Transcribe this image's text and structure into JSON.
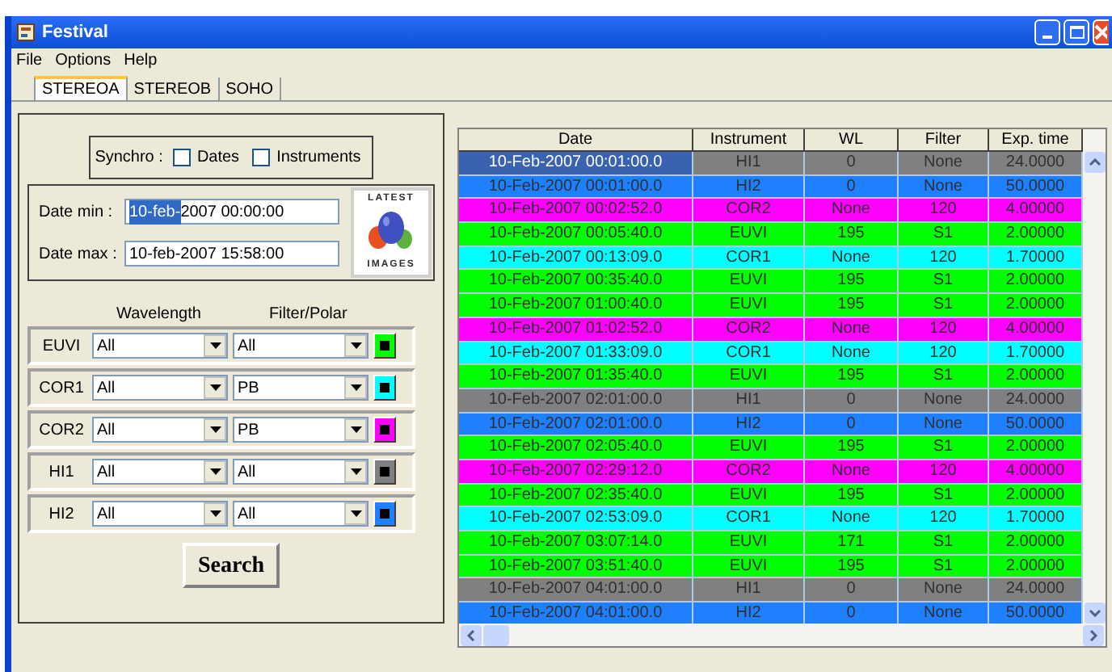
{
  "window": {
    "title": "Festival"
  },
  "menu": [
    "File",
    "Options",
    "Help"
  ],
  "tabs": [
    {
      "label": "STEREOA",
      "selected": true
    },
    {
      "label": "STEREOB",
      "selected": false
    },
    {
      "label": "SOHO",
      "selected": false
    }
  ],
  "synchro": {
    "label": "Synchro :",
    "options": [
      {
        "label": "Dates",
        "checked": false
      },
      {
        "label": "Instruments",
        "checked": false
      }
    ]
  },
  "date_min": {
    "label": "Date min :",
    "value_selected": "10-feb-",
    "value_rest": "2007 00:00:00"
  },
  "date_max": {
    "label": "Date max :",
    "value": "10-feb-2007 15:58:00"
  },
  "latest_images": {
    "top": "LATEST",
    "bottom": "IMAGES"
  },
  "filter_headers": [
    "Wavelength",
    "Filter/Polar"
  ],
  "instruments": [
    {
      "name": "EUVI",
      "wavelength": "All",
      "filter": "All",
      "color": "#00ff00"
    },
    {
      "name": "COR1",
      "wavelength": "All",
      "filter": "PB",
      "color": "#00ffff"
    },
    {
      "name": "COR2",
      "wavelength": "All",
      "filter": "PB",
      "color": "#ff00ff"
    },
    {
      "name": "HI1",
      "wavelength": "All",
      "filter": "All",
      "color": "#808080"
    },
    {
      "name": "HI2",
      "wavelength": "All",
      "filter": "All",
      "color": "#1e7fff"
    }
  ],
  "search_button": "Search",
  "table": {
    "columns": [
      "Date",
      "Instrument",
      "WL",
      "Filter",
      "Exp. time"
    ],
    "rows": [
      {
        "cells": [
          "10-Feb-2007 00:01:00.0",
          "HI1",
          "0",
          "None",
          "24.0000"
        ],
        "color": "#808080",
        "selected": true
      },
      {
        "cells": [
          "10-Feb-2007 00:01:00.0",
          "HI2",
          "0",
          "None",
          "50.0000"
        ],
        "color": "#1e7fff",
        "selected": false
      },
      {
        "cells": [
          "10-Feb-2007 00:02:52.0",
          "COR2",
          "None",
          "120",
          "4.00000"
        ],
        "color": "#ff00ff",
        "selected": false
      },
      {
        "cells": [
          "10-Feb-2007 00:05:40.0",
          "EUVI",
          "195",
          "S1",
          "2.00000"
        ],
        "color": "#00ff00",
        "selected": false
      },
      {
        "cells": [
          "10-Feb-2007 00:13:09.0",
          "COR1",
          "None",
          "120",
          "1.70000"
        ],
        "color": "#00ffff",
        "selected": false
      },
      {
        "cells": [
          "10-Feb-2007 00:35:40.0",
          "EUVI",
          "195",
          "S1",
          "2.00000"
        ],
        "color": "#00ff00",
        "selected": false
      },
      {
        "cells": [
          "10-Feb-2007 01:00:40.0",
          "EUVI",
          "195",
          "S1",
          "2.00000"
        ],
        "color": "#00ff00",
        "selected": false
      },
      {
        "cells": [
          "10-Feb-2007 01:02:52.0",
          "COR2",
          "None",
          "120",
          "4.00000"
        ],
        "color": "#ff00ff",
        "selected": false
      },
      {
        "cells": [
          "10-Feb-2007 01:33:09.0",
          "COR1",
          "None",
          "120",
          "1.70000"
        ],
        "color": "#00ffff",
        "selected": false
      },
      {
        "cells": [
          "10-Feb-2007 01:35:40.0",
          "EUVI",
          "195",
          "S1",
          "2.00000"
        ],
        "color": "#00ff00",
        "selected": false
      },
      {
        "cells": [
          "10-Feb-2007 02:01:00.0",
          "HI1",
          "0",
          "None",
          "24.0000"
        ],
        "color": "#808080",
        "selected": false
      },
      {
        "cells": [
          "10-Feb-2007 02:01:00.0",
          "HI2",
          "0",
          "None",
          "50.0000"
        ],
        "color": "#1e7fff",
        "selected": false
      },
      {
        "cells": [
          "10-Feb-2007 02:05:40.0",
          "EUVI",
          "195",
          "S1",
          "2.00000"
        ],
        "color": "#00ff00",
        "selected": false
      },
      {
        "cells": [
          "10-Feb-2007 02:29:12.0",
          "COR2",
          "None",
          "120",
          "4.00000"
        ],
        "color": "#ff00ff",
        "selected": false
      },
      {
        "cells": [
          "10-Feb-2007 02:35:40.0",
          "EUVI",
          "195",
          "S1",
          "2.00000"
        ],
        "color": "#00ff00",
        "selected": false
      },
      {
        "cells": [
          "10-Feb-2007 02:53:09.0",
          "COR1",
          "None",
          "120",
          "1.70000"
        ],
        "color": "#00ffff",
        "selected": false
      },
      {
        "cells": [
          "10-Feb-2007 03:07:14.0",
          "EUVI",
          "171",
          "S1",
          "2.00000"
        ],
        "color": "#00ff00",
        "selected": false
      },
      {
        "cells": [
          "10-Feb-2007 03:51:40.0",
          "EUVI",
          "195",
          "S1",
          "2.00000"
        ],
        "color": "#00ff00",
        "selected": false
      },
      {
        "cells": [
          "10-Feb-2007 04:01:00.0",
          "HI1",
          "0",
          "None",
          "24.0000"
        ],
        "color": "#808080",
        "selected": false
      },
      {
        "cells": [
          "10-Feb-2007 04:01:00.0",
          "HI2",
          "0",
          "None",
          "50.0000"
        ],
        "color": "#1e7fff",
        "selected": false
      }
    ]
  }
}
